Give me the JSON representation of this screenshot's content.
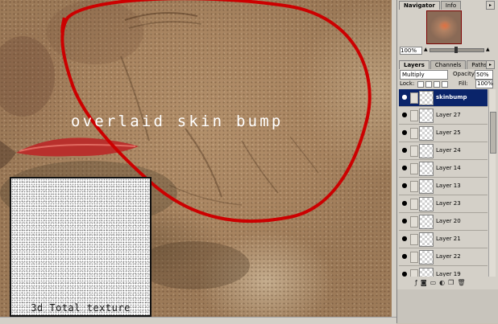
{
  "canvas": {
    "annotation_text": "overlaid skin bump",
    "texture_caption": "3d Total texture",
    "circle_color": "#cc0000"
  },
  "navigator_panel": {
    "tabs": [
      "Navigator",
      "Info"
    ],
    "zoom": "100%"
  },
  "layers_panel": {
    "tabs": [
      "Layers",
      "Channels",
      "Paths"
    ],
    "blend_mode": "Multiply",
    "opacity_label": "Opacity:",
    "opacity_value": "50%",
    "lock_label": "Lock:",
    "fill_label": "Fill:",
    "fill_value": "100%",
    "layers": [
      {
        "name": "skinbump",
        "selected": true
      },
      {
        "name": "Layer 27",
        "selected": false
      },
      {
        "name": "Layer 25",
        "selected": false
      },
      {
        "name": "Layer 24",
        "selected": false
      },
      {
        "name": "Layer 14",
        "selected": false
      },
      {
        "name": "Layer 13",
        "selected": false
      },
      {
        "name": "Layer 23",
        "selected": false
      },
      {
        "name": "Layer 20",
        "selected": false
      },
      {
        "name": "Layer 21",
        "selected": false
      },
      {
        "name": "Layer 22",
        "selected": false
      },
      {
        "name": "Layer 19",
        "selected": false
      }
    ],
    "highlight_color": "#0a246a"
  },
  "icons": [
    "eye-icon",
    "link-icon",
    "layer-style-icon",
    "mask-icon",
    "new-set-icon",
    "adjustment-icon",
    "new-layer-icon",
    "trash-icon"
  ]
}
